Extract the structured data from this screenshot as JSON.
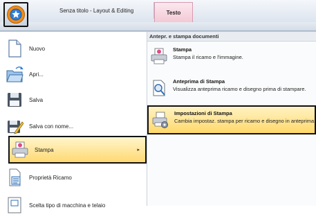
{
  "titlebar": {
    "title": "Senza titolo - Layout & Editing",
    "active_tab": "Testo"
  },
  "app_menu": {
    "left_items": [
      {
        "label": "Nuovo",
        "icon": "new-document-icon"
      },
      {
        "label": "Apri...",
        "icon": "open-folder-icon"
      },
      {
        "label": "Salva",
        "icon": "save-icon"
      },
      {
        "label": "Salva con nome...",
        "icon": "save-as-icon"
      },
      {
        "label": "Stampa",
        "icon": "print-icon",
        "highlighted": true,
        "has_submenu": true
      },
      {
        "label": "Proprietà Ricamo",
        "icon": "embroidery-properties-icon"
      },
      {
        "label": "Scelta tipo di macchina e telaio",
        "icon": "machine-hoop-icon"
      }
    ],
    "submenu": {
      "header": "Antepr. e stampa documenti",
      "items": [
        {
          "title": "Stampa",
          "description": "Stampa il ricamo e l'immagine.",
          "icon": "print-icon"
        },
        {
          "title": "Anteprima di Stampa",
          "description": "Visualizza anteprima ricamo e disegno prima di stampare.",
          "icon": "print-preview-icon"
        },
        {
          "title": "Impostazioni di Stampa",
          "description": "Cambia impostaz. stampa per ricamo e disegno in anteprima.",
          "icon": "print-settings-icon",
          "highlighted": true
        }
      ]
    }
  },
  "colors": {
    "highlight": "#ffd972",
    "outline": "#111111",
    "tab_pink": "#f3c9d6"
  }
}
